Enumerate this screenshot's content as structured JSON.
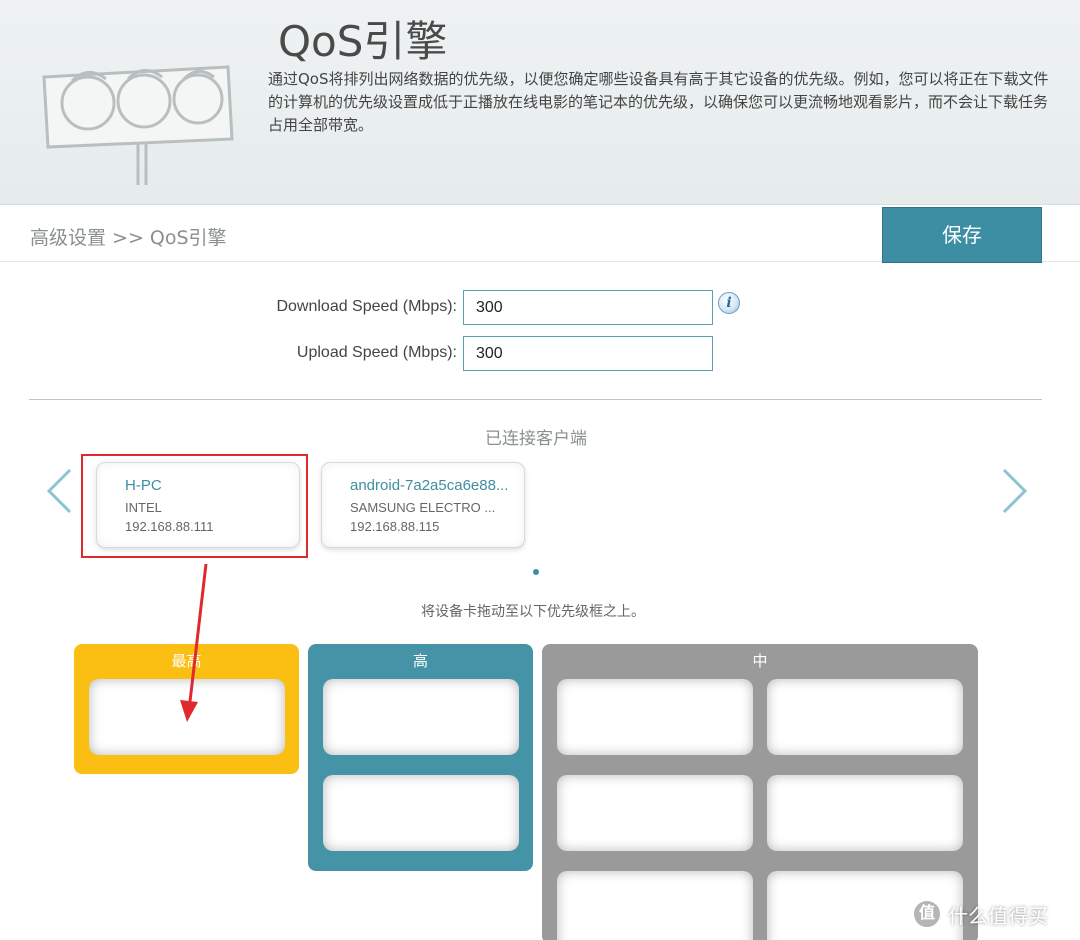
{
  "header": {
    "title": "QoS引擎",
    "description": "通过QoS将排列出网络数据的优先级，以便您确定哪些设备具有高于其它设备的优先级。例如，您可以将正在下载文件的计算机的优先级设置成低于正播放在线电影的笔记本的优先级，以确保您可以更流畅地观看影片，而不会让下载任务占用全部带宽。"
  },
  "breadcrumb": "高级设置 >> QoS引擎",
  "save_label": "保存",
  "form": {
    "download_label": "Download Speed (Mbps):",
    "download_value": "300",
    "upload_label": "Upload Speed (Mbps):",
    "upload_value": "300",
    "info_glyph": "i"
  },
  "clients_title": "已连接客户端",
  "clients": [
    {
      "name": "H-PC",
      "vendor": "INTEL",
      "ip": "192.168.88.111"
    },
    {
      "name": "android-7a2a5ca6e88...",
      "vendor": "SAMSUNG ELECTRO ...",
      "ip": "192.168.88.115"
    }
  ],
  "hint": "将设备卡拖动至以下优先级框之上。",
  "priorities": {
    "highest": "最高",
    "high": "高",
    "medium": "中"
  },
  "colors": {
    "accent": "#3e8ea3",
    "highest": "#fbbf13",
    "high": "#4493a6",
    "medium": "#9a9a9a",
    "annotation": "#e0292f"
  },
  "watermark": {
    "logo": "值",
    "text": "什么值得买"
  }
}
